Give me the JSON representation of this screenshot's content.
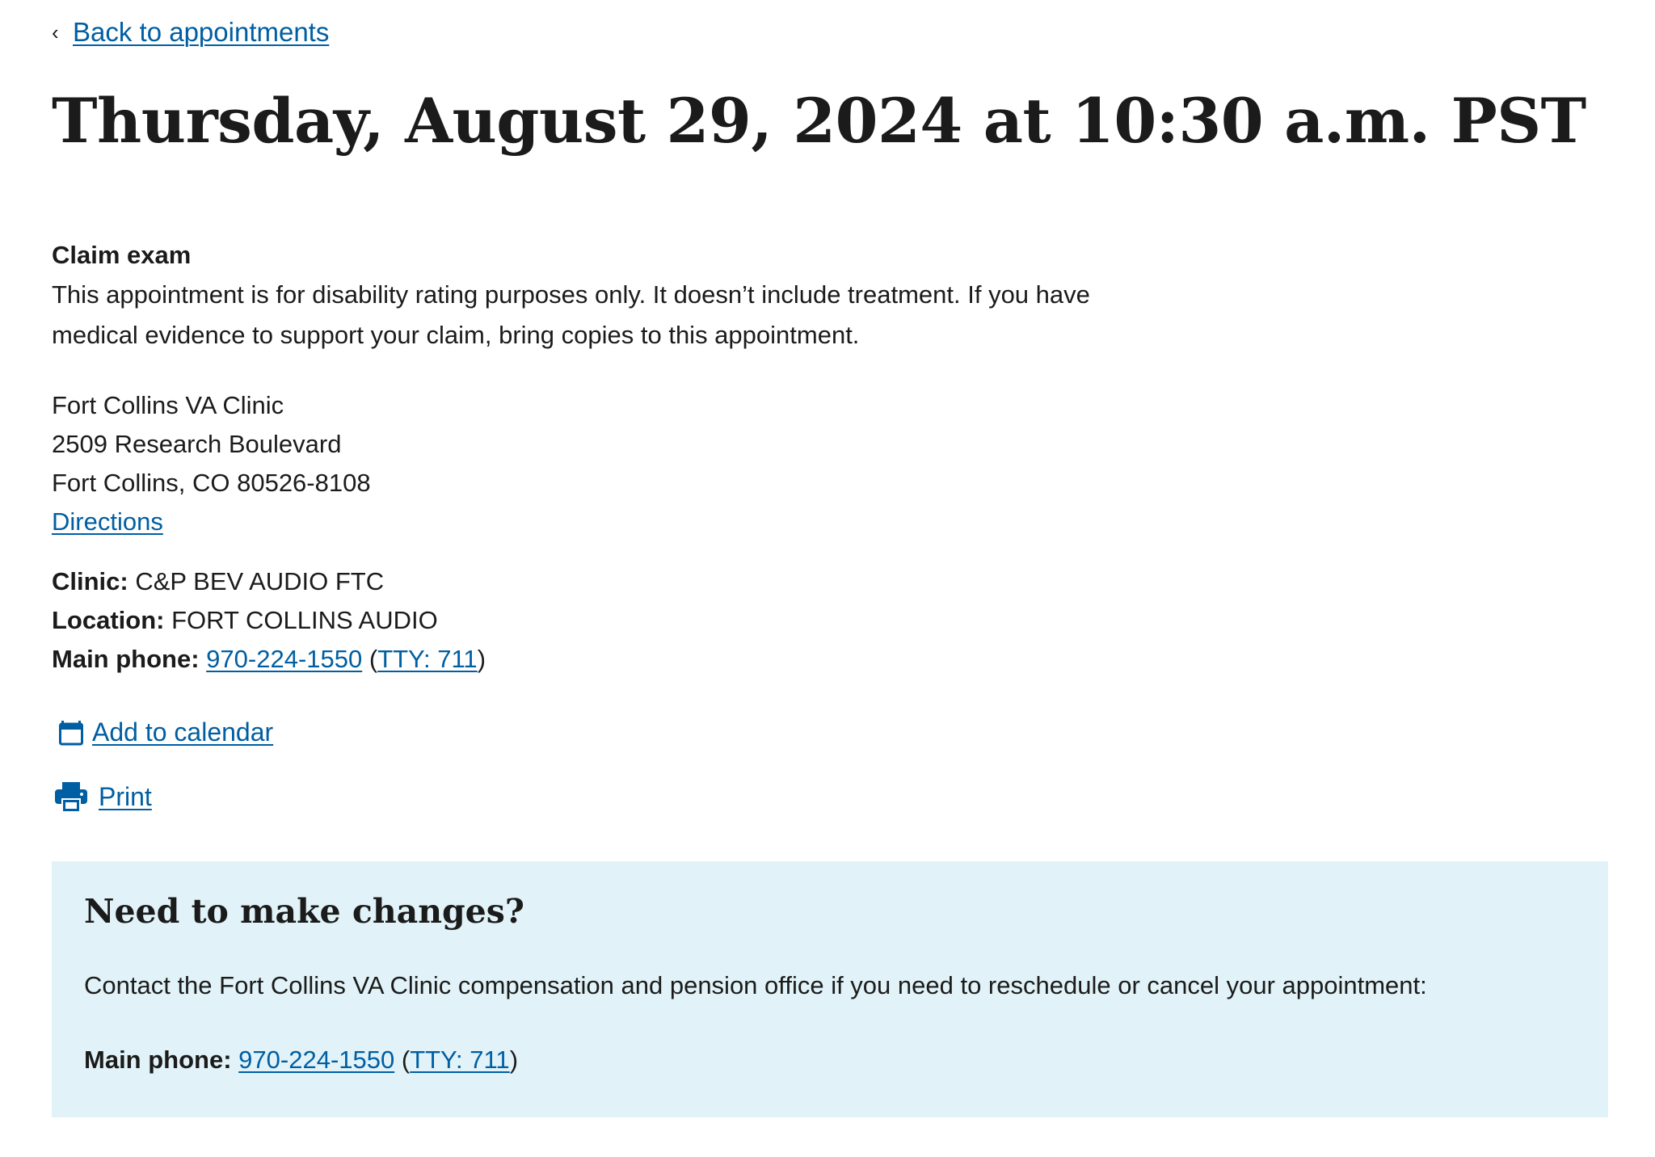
{
  "breadcrumb": {
    "chevron": "‹",
    "label": "Back to appointments"
  },
  "title": "Thursday, August 29, 2024 at 10:30 a.m. PST",
  "appointment": {
    "type": "Claim exam",
    "description": "This appointment is for disability rating purposes only. It doesn’t include treatment. If you have medical evidence to support your claim, bring copies to this appointment."
  },
  "facility": {
    "name": "Fort Collins VA Clinic",
    "street": "2509 Research Boulevard",
    "city_state_zip": "Fort Collins, CO 80526-8108",
    "directions_label": "Directions"
  },
  "details": {
    "clinic_label": "Clinic:",
    "clinic_value": "C&P BEV AUDIO FTC",
    "location_label": "Location:",
    "location_value": "FORT COLLINS AUDIO",
    "phone_label": "Main phone:",
    "phone_number": "970-224-1550",
    "tty": "TTY: 711",
    "open_paren": "(",
    "close_paren": ")"
  },
  "actions": {
    "calendar_icon": "calendar-icon",
    "calendar_label": "Add to calendar",
    "print_icon": "printer-icon",
    "print_label": "Print"
  },
  "callout": {
    "heading": "Need to make changes?",
    "text": "Contact the Fort Collins VA Clinic compensation and pension office if you need to reschedule or cancel your appointment:",
    "phone_label": "Main phone:",
    "phone_number": "970-224-1550",
    "tty": "TTY: 711",
    "open_paren": "(",
    "close_paren": ")",
    "background": "#e1f3f8"
  },
  "colors": {
    "link": "#005ea2",
    "text": "#1b1b1b"
  }
}
